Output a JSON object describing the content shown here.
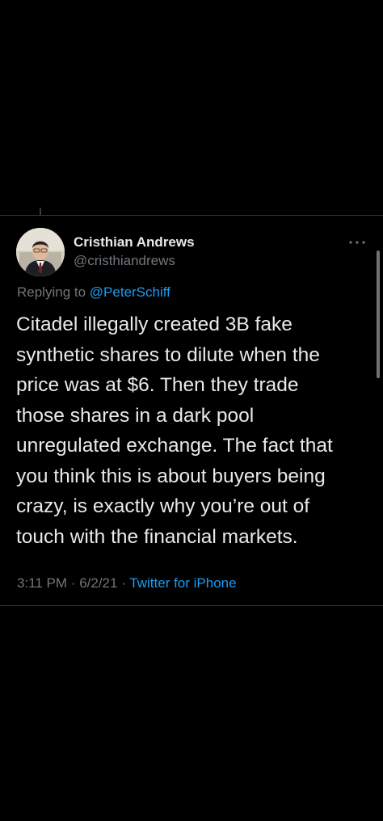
{
  "tweet": {
    "author": {
      "display_name": "Cristhian Andrews",
      "handle": "@cristhiandrews"
    },
    "reply": {
      "prefix": "Replying to",
      "mention": "@PeterSchiff"
    },
    "text_lines": [
      "Citadel illegally created 3B fake",
      "synthetic shares to dilute when the",
      "price was at $6. Then they trade",
      "those shares in a dark pool",
      "unregulated exchange. The fact that",
      "you think this is about buyers being",
      "crazy, is exactly why you’re out of",
      "touch with the financial markets."
    ],
    "meta": {
      "time": "3:11 PM",
      "separator": "·",
      "date": "6/2/21",
      "source": "Twitter for iPhone"
    },
    "icons": {
      "more": "more-horizontal-icon",
      "avatar": "profile-photo"
    },
    "colors": {
      "background": "#000000",
      "text": "#e7e9ea",
      "secondary": "#71767b",
      "link": "#1d9bf0",
      "divider": "#2f3336"
    }
  }
}
